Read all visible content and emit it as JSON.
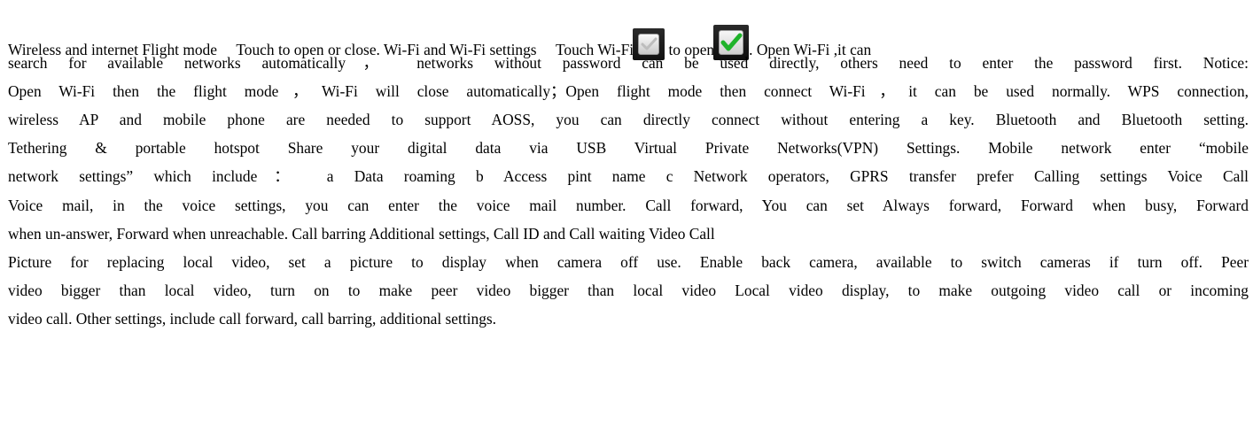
{
  "doc": {
    "line1": {
      "part1": "Wireless and internet Flight mode     Touch to open or close. Wi-Fi and Wi-Fi settings     Touch Wi-Fi",
      "part2": " to open",
      "part3": ". Open Wi-Fi ,it can"
    },
    "line2": "search for available networks automatically， networks without password can be used directly, others need to enter the password first. Notice:",
    "line3": "Open Wi-Fi then the flight mode，Wi-Fi will close automatically；Open flight mode then connect Wi-Fi，it can be used normally. WPS connection,",
    "line4": "wireless AP and mobile phone are needed to support AOSS, you can directly connect without entering a key. Bluetooth and Bluetooth setting.",
    "line5": "Tethering & portable hotspot    Share your digital data via USB Virtual Private Networks(VPN) Settings. Mobile network    enter “mobile",
    "line6": "network settings” which include：   a Data roaming b Access pint name c Network operators, GPRS transfer prefer Calling settings Voice Call",
    "line7": "Voice mail, in the voice settings, you can enter the voice mail number. Call forward, You can set Always forward, Forward when busy, Forward",
    "line8": "when un-answer, Forward when unreachable. Call barring Additional settings, Call ID and Call waiting Video Call",
    "line9": "Picture for replacing local video, set a picture to display when camera off use. Enable back camera, available to switch cameras if turn off. Peer",
    "line10": "video bigger than local video, turn on to make peer video bigger than local video Local video display, to make outgoing video call or incoming",
    "line11": "video call. Other settings, include call forward, call barring, additional settings."
  },
  "icons": {
    "checkbox_unchecked": "checkbox-unchecked-icon",
    "checkbox_checked": "checkbox-checked-icon"
  },
  "colors": {
    "check_green": "#1fb32a",
    "check_gray": "#bdbdbd"
  }
}
